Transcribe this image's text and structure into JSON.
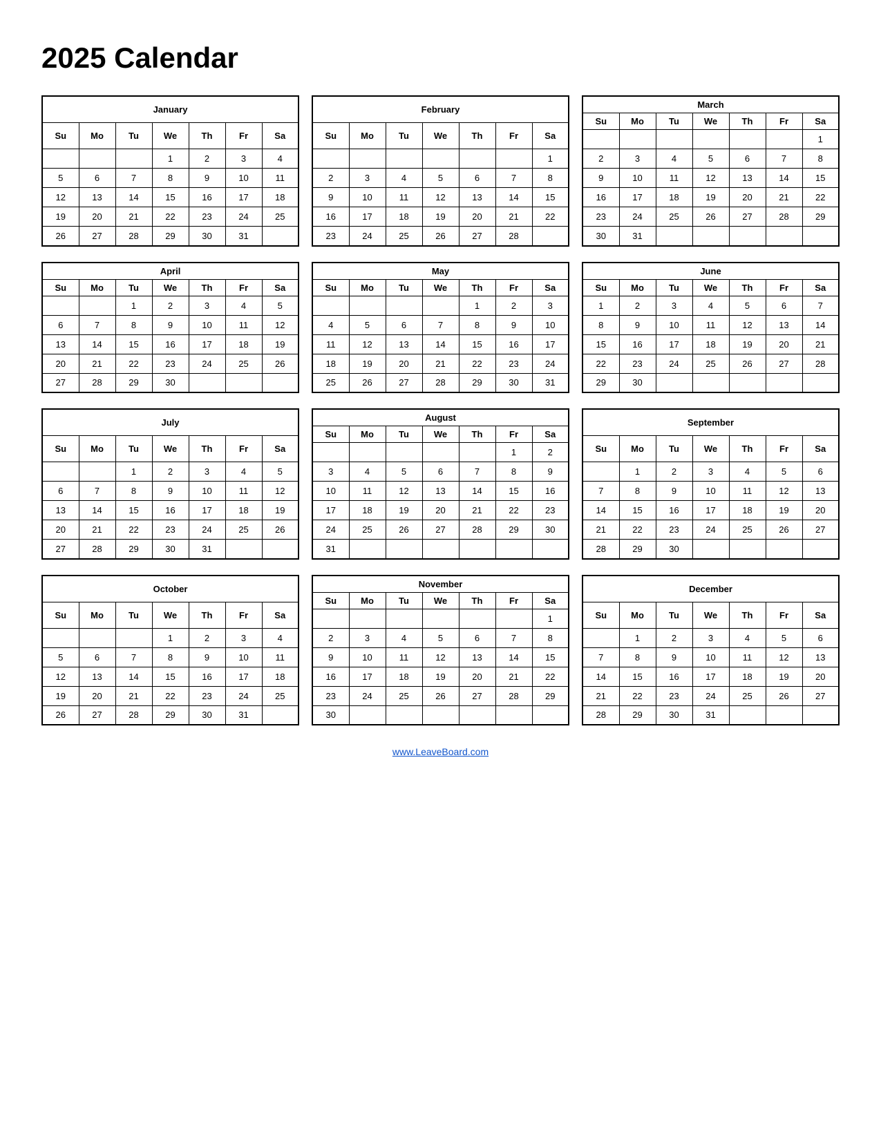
{
  "title": "2025 Calendar",
  "footer_link": "www.LeaveBoard.com",
  "months": [
    {
      "name": "January",
      "days_header": [
        "Su",
        "Mo",
        "Tu",
        "We",
        "Th",
        "Fr",
        "Sa"
      ],
      "weeks": [
        [
          "",
          "",
          "",
          "1",
          "2",
          "3",
          "4"
        ],
        [
          "5",
          "6",
          "7",
          "8",
          "9",
          "10",
          "11"
        ],
        [
          "12",
          "13",
          "14",
          "15",
          "16",
          "17",
          "18"
        ],
        [
          "19",
          "20",
          "21",
          "22",
          "23",
          "24",
          "25"
        ],
        [
          "26",
          "27",
          "28",
          "29",
          "30",
          "31",
          ""
        ]
      ]
    },
    {
      "name": "February",
      "days_header": [
        "Su",
        "Mo",
        "Tu",
        "We",
        "Th",
        "Fr",
        "Sa"
      ],
      "weeks": [
        [
          "",
          "",
          "",
          "",
          "",
          "",
          "1"
        ],
        [
          "2",
          "3",
          "4",
          "5",
          "6",
          "7",
          "8"
        ],
        [
          "9",
          "10",
          "11",
          "12",
          "13",
          "14",
          "15"
        ],
        [
          "16",
          "17",
          "18",
          "19",
          "20",
          "21",
          "22"
        ],
        [
          "23",
          "24",
          "25",
          "26",
          "27",
          "28",
          ""
        ]
      ]
    },
    {
      "name": "March",
      "days_header": [
        "Su",
        "Mo",
        "Tu",
        "We",
        "Th",
        "Fr",
        "Sa"
      ],
      "weeks": [
        [
          "",
          "",
          "",
          "",
          "",
          "",
          "1"
        ],
        [
          "2",
          "3",
          "4",
          "5",
          "6",
          "7",
          "8"
        ],
        [
          "9",
          "10",
          "11",
          "12",
          "13",
          "14",
          "15"
        ],
        [
          "16",
          "17",
          "18",
          "19",
          "20",
          "21",
          "22"
        ],
        [
          "23",
          "24",
          "25",
          "26",
          "27",
          "28",
          "29"
        ],
        [
          "30",
          "31",
          "",
          "",
          "",
          "",
          ""
        ]
      ]
    },
    {
      "name": "April",
      "days_header": [
        "Su",
        "Mo",
        "Tu",
        "We",
        "Th",
        "Fr",
        "Sa"
      ],
      "weeks": [
        [
          "",
          "",
          "1",
          "2",
          "3",
          "4",
          "5"
        ],
        [
          "6",
          "7",
          "8",
          "9",
          "10",
          "11",
          "12"
        ],
        [
          "13",
          "14",
          "15",
          "16",
          "17",
          "18",
          "19"
        ],
        [
          "20",
          "21",
          "22",
          "23",
          "24",
          "25",
          "26"
        ],
        [
          "27",
          "28",
          "29",
          "30",
          "",
          "",
          ""
        ]
      ]
    },
    {
      "name": "May",
      "days_header": [
        "Su",
        "Mo",
        "Tu",
        "We",
        "Th",
        "Fr",
        "Sa"
      ],
      "weeks": [
        [
          "",
          "",
          "",
          "",
          "1",
          "2",
          "3"
        ],
        [
          "4",
          "5",
          "6",
          "7",
          "8",
          "9",
          "10"
        ],
        [
          "11",
          "12",
          "13",
          "14",
          "15",
          "16",
          "17"
        ],
        [
          "18",
          "19",
          "20",
          "21",
          "22",
          "23",
          "24"
        ],
        [
          "25",
          "26",
          "27",
          "28",
          "29",
          "30",
          "31"
        ]
      ]
    },
    {
      "name": "June",
      "days_header": [
        "Su",
        "Mo",
        "Tu",
        "We",
        "Th",
        "Fr",
        "Sa"
      ],
      "weeks": [
        [
          "1",
          "2",
          "3",
          "4",
          "5",
          "6",
          "7"
        ],
        [
          "8",
          "9",
          "10",
          "11",
          "12",
          "13",
          "14"
        ],
        [
          "15",
          "16",
          "17",
          "18",
          "19",
          "20",
          "21"
        ],
        [
          "22",
          "23",
          "24",
          "25",
          "26",
          "27",
          "28"
        ],
        [
          "29",
          "30",
          "",
          "",
          "",
          "",
          ""
        ]
      ]
    },
    {
      "name": "July",
      "days_header": [
        "Su",
        "Mo",
        "Tu",
        "We",
        "Th",
        "Fr",
        "Sa"
      ],
      "weeks": [
        [
          "",
          "",
          "1",
          "2",
          "3",
          "4",
          "5"
        ],
        [
          "6",
          "7",
          "8",
          "9",
          "10",
          "11",
          "12"
        ],
        [
          "13",
          "14",
          "15",
          "16",
          "17",
          "18",
          "19"
        ],
        [
          "20",
          "21",
          "22",
          "23",
          "24",
          "25",
          "26"
        ],
        [
          "27",
          "28",
          "29",
          "30",
          "31",
          "",
          ""
        ]
      ]
    },
    {
      "name": "August",
      "days_header": [
        "Su",
        "Mo",
        "Tu",
        "We",
        "Th",
        "Fr",
        "Sa"
      ],
      "weeks": [
        [
          "",
          "",
          "",
          "",
          "",
          "1",
          "2"
        ],
        [
          "3",
          "4",
          "5",
          "6",
          "7",
          "8",
          "9"
        ],
        [
          "10",
          "11",
          "12",
          "13",
          "14",
          "15",
          "16"
        ],
        [
          "17",
          "18",
          "19",
          "20",
          "21",
          "22",
          "23"
        ],
        [
          "24",
          "25",
          "26",
          "27",
          "28",
          "29",
          "30"
        ],
        [
          "31",
          "",
          "",
          "",
          "",
          "",
          ""
        ]
      ]
    },
    {
      "name": "September",
      "days_header": [
        "Su",
        "Mo",
        "Tu",
        "We",
        "Th",
        "Fr",
        "Sa"
      ],
      "weeks": [
        [
          "",
          "1",
          "2",
          "3",
          "4",
          "5",
          "6"
        ],
        [
          "7",
          "8",
          "9",
          "10",
          "11",
          "12",
          "13"
        ],
        [
          "14",
          "15",
          "16",
          "17",
          "18",
          "19",
          "20"
        ],
        [
          "21",
          "22",
          "23",
          "24",
          "25",
          "26",
          "27"
        ],
        [
          "28",
          "29",
          "30",
          "",
          "",
          "",
          ""
        ]
      ]
    },
    {
      "name": "October",
      "days_header": [
        "Su",
        "Mo",
        "Tu",
        "We",
        "Th",
        "Fr",
        "Sa"
      ],
      "weeks": [
        [
          "",
          "",
          "",
          "1",
          "2",
          "3",
          "4"
        ],
        [
          "5",
          "6",
          "7",
          "8",
          "9",
          "10",
          "11"
        ],
        [
          "12",
          "13",
          "14",
          "15",
          "16",
          "17",
          "18"
        ],
        [
          "19",
          "20",
          "21",
          "22",
          "23",
          "24",
          "25"
        ],
        [
          "26",
          "27",
          "28",
          "29",
          "30",
          "31",
          ""
        ]
      ]
    },
    {
      "name": "November",
      "days_header": [
        "Su",
        "Mo",
        "Tu",
        "We",
        "Th",
        "Fr",
        "Sa"
      ],
      "weeks": [
        [
          "",
          "",
          "",
          "",
          "",
          "",
          "1"
        ],
        [
          "2",
          "3",
          "4",
          "5",
          "6",
          "7",
          "8"
        ],
        [
          "9",
          "10",
          "11",
          "12",
          "13",
          "14",
          "15"
        ],
        [
          "16",
          "17",
          "18",
          "19",
          "20",
          "21",
          "22"
        ],
        [
          "23",
          "24",
          "25",
          "26",
          "27",
          "28",
          "29"
        ],
        [
          "30",
          "",
          "",
          "",
          "",
          "",
          ""
        ]
      ]
    },
    {
      "name": "December",
      "days_header": [
        "Su",
        "Mo",
        "Tu",
        "We",
        "Th",
        "Fr",
        "Sa"
      ],
      "weeks": [
        [
          "",
          "1",
          "2",
          "3",
          "4",
          "5",
          "6"
        ],
        [
          "7",
          "8",
          "9",
          "10",
          "11",
          "12",
          "13"
        ],
        [
          "14",
          "15",
          "16",
          "17",
          "18",
          "19",
          "20"
        ],
        [
          "21",
          "22",
          "23",
          "24",
          "25",
          "26",
          "27"
        ],
        [
          "28",
          "29",
          "30",
          "31",
          "",
          "",
          ""
        ]
      ]
    }
  ]
}
